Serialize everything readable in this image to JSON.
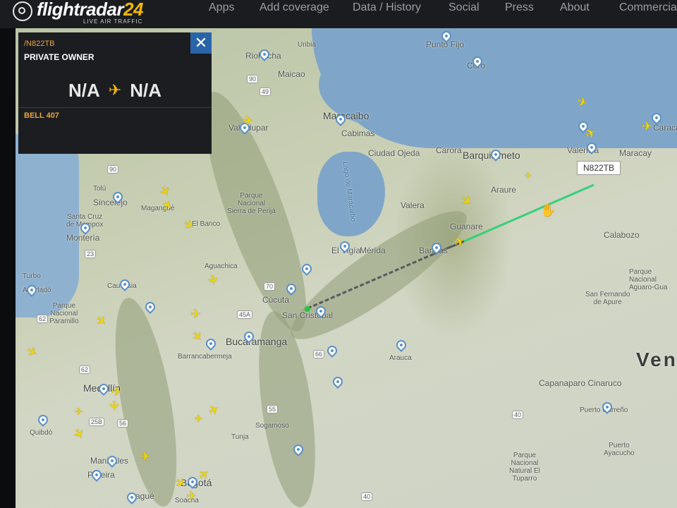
{
  "app": {
    "logo_text": "flightradar",
    "logo_num": "24",
    "logo_tagline": "LIVE AIR TRAFFIC"
  },
  "nav": {
    "items": [
      "Apps",
      "Add coverage",
      "Data / History",
      "Social",
      "Press",
      "About",
      "Commercia"
    ]
  },
  "panel": {
    "callsign": "/N822TB",
    "owner": "PRIVATE OWNER",
    "from": "N/A",
    "to": "N/A",
    "aircraft": "BELL 407",
    "close": "✕"
  },
  "map": {
    "aircraft_tag": "N822TB",
    "country_label": "Ven",
    "water_label": "Lago de Maracaibo",
    "labels": {
      "riohacha": "Riohacha",
      "uribia": "Uribia",
      "maicao": "Maicao",
      "punto_fijo": "Punto Fijo",
      "coro": "Coro",
      "maracaibo": "Maracaibo",
      "cabimas": "Cabimas",
      "ciudad_ojeda": "Ciudad Ojeda",
      "carora": "Carora",
      "barquisimeto": "Barquisimeto",
      "valencia": "Valencia",
      "maracay": "Maracay",
      "caracas": "Caraca",
      "valledupar": "Valledupar",
      "sincelejo": "Sincelejo",
      "magangue": "Magangué",
      "tolu": "Tolú",
      "santa_cruz": "Santa Cruz\nde Mompox",
      "monteria": "Montería",
      "el_banco": "El Banco",
      "perija": "Parque\nNacional\nSierra de Perijá",
      "aguachica": "Aguachica",
      "caucasia": "Caucasia",
      "turbo": "Turbo",
      "apartado": "Apartadó",
      "paramillo": "Parque\nNacional\nParamillo",
      "cucuta": "Cúcuta",
      "san_cristobal": "San Cristóbal",
      "el_vigia": "El Vigía",
      "merida": "Mérida",
      "barinas": "Barinas",
      "valera": "Valera",
      "guanare": "Guanare",
      "araure": "Araure",
      "calabozo": "Calabozo",
      "aguaro": "Parque\nNacional\nAguaro-Gua",
      "san_fernando": "San Fernando\nde Apure",
      "bucaramanga": "Bucaramanga",
      "barrancabermeja": "Barrancabermeja",
      "arauca": "Arauca",
      "capanaparo": "Capanaparo Cinaruco",
      "puerto_carreno": "Puerto Carreño",
      "puerto_ayacucho": "Puerto\nAyacucho",
      "tuparro": "Parque\nNacional\nNatural El\nTuparro",
      "medellin": "Medellín",
      "quibdo": "Quibdó",
      "manizales": "Manizales",
      "pereira": "Pereira",
      "ibague": "Ibagué",
      "bogota": "Bogotá",
      "soacha": "Soacha",
      "tunja": "Tunja",
      "sogamoso": "Sogamoso"
    },
    "roads": [
      "90",
      "49",
      "90",
      "23",
      "62",
      "45A",
      "70",
      "66",
      "55",
      "62",
      "25B",
      "56",
      "40",
      "40"
    ]
  },
  "colors": {
    "track_recent": "#35d07a",
    "track_old": "#555a5e",
    "plane": "#f2d70a",
    "panel_accent": "#e9a63a",
    "close_button": "#2a64a8"
  }
}
